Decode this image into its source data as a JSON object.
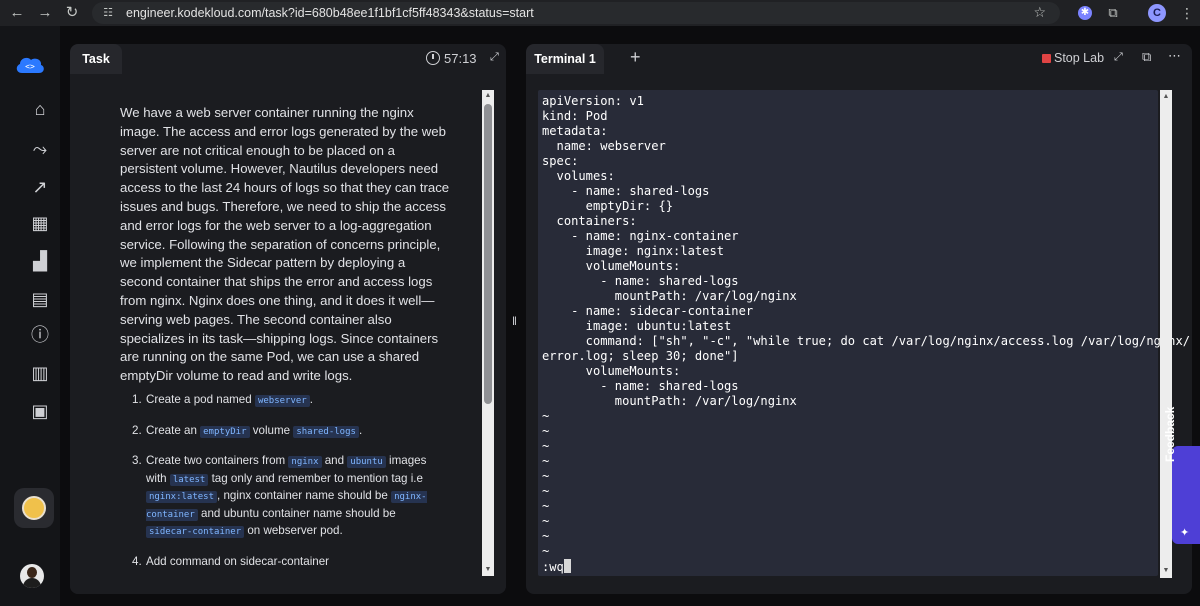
{
  "browser": {
    "back_icon": "arrow-left-icon",
    "forward_icon": "arrow-right-icon",
    "reload_icon": "reload-icon",
    "url": "engineer.kodekloud.com/task?id=680b48ee1f1bf1cf5ff48343&status=start",
    "profile_initial": "C"
  },
  "sidebar": {
    "items": [
      {
        "name": "home",
        "icon": "home-icon"
      },
      {
        "name": "roadmap",
        "icon": "route-icon"
      },
      {
        "name": "progress",
        "icon": "chart-icon"
      },
      {
        "name": "videos",
        "icon": "clapper-icon"
      },
      {
        "name": "leaderboard",
        "icon": "podium-icon"
      },
      {
        "name": "feedback",
        "icon": "message-icon"
      },
      {
        "name": "info",
        "icon": "info-icon"
      },
      {
        "name": "docs",
        "icon": "book-icon"
      },
      {
        "name": "chat",
        "icon": "chat-icon"
      }
    ]
  },
  "task": {
    "tab_label": "Task",
    "timer": "57:13",
    "description": "We have a web server container running the nginx image. The access and error logs generated by the web server are not critical enough to be placed on a persistent volume. However, Nautilus developers need access to the last 24 hours of logs so that they can trace issues and bugs. Therefore, we need to ship the access and error logs for the web server to a log-aggregation service. Following the separation of concerns principle, we implement the Sidecar pattern by deploying a second container that ships the error and access logs from nginx. Nginx does one thing, and it does it well—serving web pages. The second container also specializes in its task—shipping logs. Since containers are running on the same Pod, we can use a shared emptyDir volume to read and write logs.",
    "steps": {
      "s1_num": "1.",
      "s1_a": "Create a pod named ",
      "s1_code": "webserver",
      "s1_b": ".",
      "s2_num": "2.",
      "s2_a": "Create an ",
      "s2_code1": "emptyDir",
      "s2_b": " volume ",
      "s2_code2": "shared-logs",
      "s2_c": ".",
      "s3_num": "3.",
      "s3_a": "Create two containers from ",
      "s3_code1": "nginx",
      "s3_b": " and ",
      "s3_code2": "ubuntu",
      "s3_c": " images with ",
      "s3_code3": "latest",
      "s3_d": " tag only and remember to mention tag i.e ",
      "s3_code4": "nginx:latest",
      "s3_e": ", nginx container name should be ",
      "s3_code5": "nginx-container",
      "s3_f": " and ubuntu container name should be ",
      "s3_code6": "sidecar-container",
      "s3_g": " on webserver pod.",
      "s4_num": "4.",
      "s4_a": "Add command on sidecar-container "
    }
  },
  "terminal": {
    "tab_label": "Terminal 1",
    "stop_label": "Stop Lab",
    "content": "apiVersion: v1\nkind: Pod\nmetadata:\n  name: webserver\nspec:\n  volumes:\n    - name: shared-logs\n      emptyDir: {}\n  containers:\n    - name: nginx-container\n      image: nginx:latest\n      volumeMounts:\n        - name: shared-logs\n          mountPath: /var/log/nginx\n    - name: sidecar-container\n      image: ubuntu:latest\n      command: [\"sh\", \"-c\", \"while true; do cat /var/log/nginx/access.log /var/log/nginx/\nerror.log; sleep 30; done\"]\n      volumeMounts:\n        - name: shared-logs\n          mountPath: /var/log/nginx\n~\n~\n~\n~\n~\n~\n~\n~\n~\n~\n:wq"
  },
  "feedback": {
    "label": "Feedback"
  },
  "colors": {
    "accent": "#4e3fd6",
    "stop": "#e04444",
    "terminal_bg": "#282b38",
    "code_bg": "#263350"
  }
}
